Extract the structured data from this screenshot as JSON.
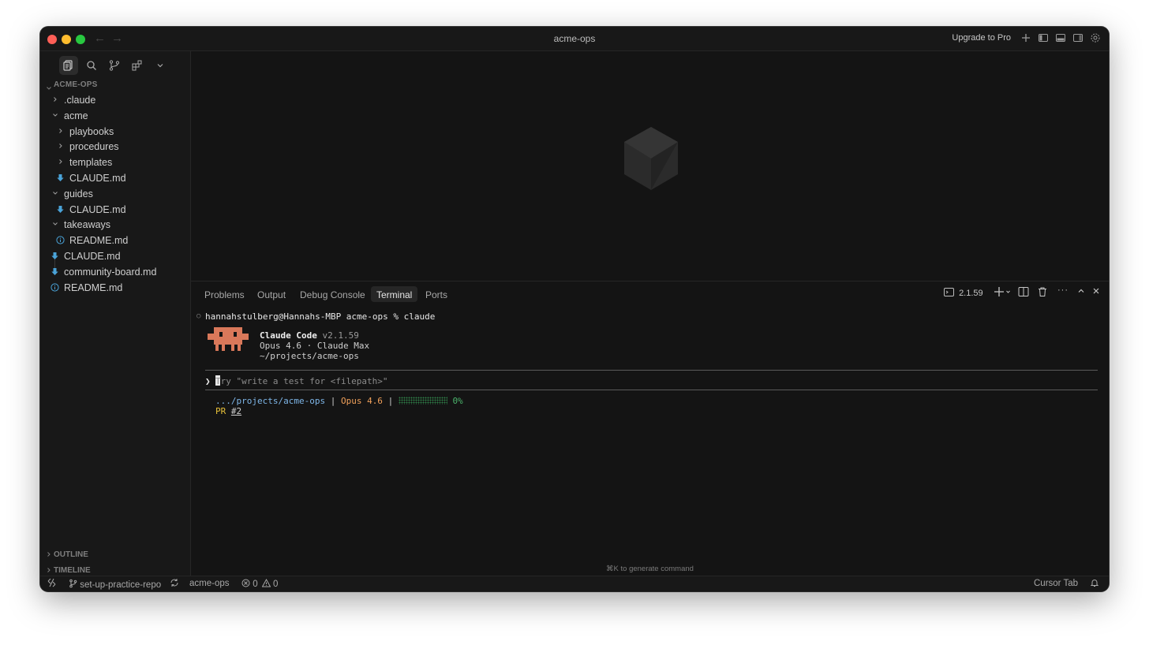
{
  "window": {
    "title": "acme-ops",
    "upgrade_label": "Upgrade to Pro"
  },
  "sidebar": {
    "section_title": "ACME-OPS",
    "tree": [
      {
        "label": ".claude",
        "type": "folder",
        "expanded": false,
        "depth": 1
      },
      {
        "label": "acme",
        "type": "folder",
        "expanded": true,
        "depth": 1
      },
      {
        "label": "playbooks",
        "type": "folder",
        "expanded": false,
        "depth": 2
      },
      {
        "label": "procedures",
        "type": "folder",
        "expanded": false,
        "depth": 2
      },
      {
        "label": "templates",
        "type": "folder",
        "expanded": false,
        "depth": 2
      },
      {
        "label": "CLAUDE.md",
        "type": "markdown",
        "depth": 2
      },
      {
        "label": "guides",
        "type": "folder",
        "expanded": true,
        "depth": 1
      },
      {
        "label": "CLAUDE.md",
        "type": "markdown",
        "depth": 2
      },
      {
        "label": "takeaways",
        "type": "folder",
        "expanded": true,
        "depth": 1
      },
      {
        "label": "README.md",
        "type": "info",
        "depth": 2
      },
      {
        "label": "CLAUDE.md",
        "type": "markdown",
        "depth": 1
      },
      {
        "label": "community-board.md",
        "type": "markdown",
        "depth": 1
      },
      {
        "label": "README.md",
        "type": "info",
        "depth": 1
      }
    ],
    "outline_label": "OUTLINE",
    "timeline_label": "TIMELINE"
  },
  "panel": {
    "tabs": [
      "Problems",
      "Output",
      "Debug Console",
      "Terminal",
      "Ports"
    ],
    "active_tab": "Terminal",
    "terminal_version": "2.1.59"
  },
  "terminal": {
    "prompt": "hannahstulberg@Hannahs-MBP acme-ops % claude",
    "app_name": "Claude Code",
    "app_version": "v2.1.59",
    "model_line": "Opus 4.6 · Claude Max",
    "path_line": "~/projects/acme-ops",
    "input_caret": "❯",
    "input_placeholder": "Try \"write a test for <filepath>\"",
    "status_path": ".../projects/acme-ops",
    "status_sep": "|",
    "status_model": "Opus 4.6",
    "status_pct": "0%",
    "context_fraction": 0,
    "pr_label": "PR",
    "pr_number": "#2",
    "hint": "⌘K to generate command"
  },
  "statusbar": {
    "branch": "set-up-practice-repo",
    "project": "acme-ops",
    "errors": "0",
    "warnings": "0",
    "cursor_tab": "Cursor Tab"
  },
  "colors": {
    "markdown_icon": "#4aa3d8",
    "info_icon": "#4aa3d8",
    "claude_logo": "#d9785a",
    "path_blue": "#7eb6e8",
    "model_orange": "#f0a05a",
    "pct_green": "#4bb36b",
    "pr_yellow": "#e8c23a"
  }
}
